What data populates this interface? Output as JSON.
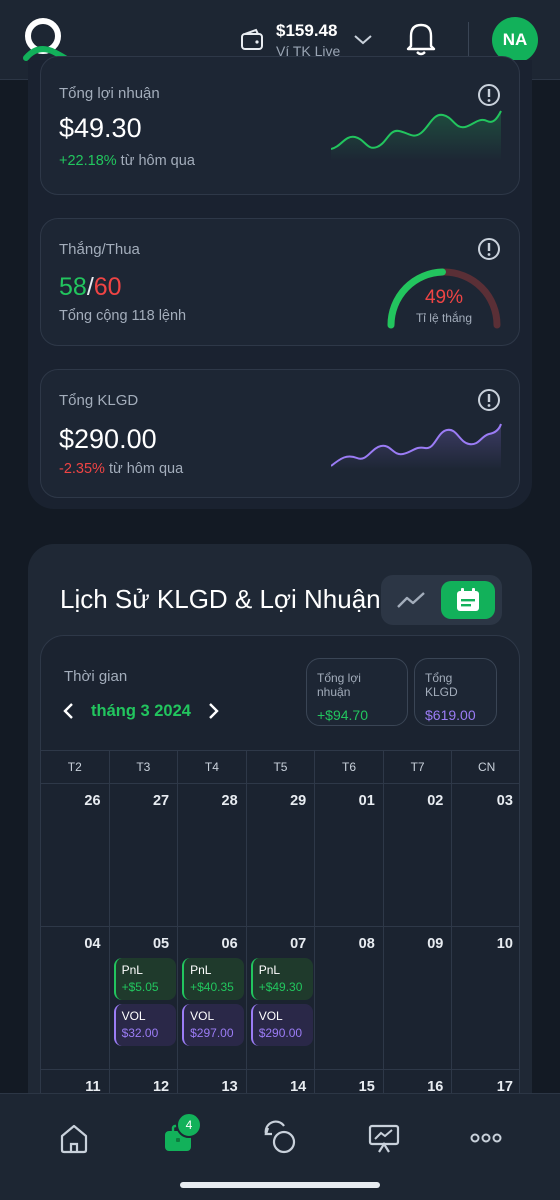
{
  "header": {
    "wallet_balance": "$159.48",
    "wallet_label": "Ví TK Live",
    "avatar_initials": "NA"
  },
  "stats": {
    "profit": {
      "title": "Tổng lợi nhuận",
      "value": "$49.30",
      "change": "+22.18%",
      "change_suffix": " từ hôm qua"
    },
    "winloss": {
      "title": "Thắng/Thua",
      "wins": "58",
      "separator": "/",
      "losses": "60",
      "total": "Tổng cộng 118 lệnh",
      "rate": "49%",
      "rate_label": "Tỉ lệ thắng",
      "win_fraction": 0.49
    },
    "volume": {
      "title": "Tổng KLGD",
      "value": "$290.00",
      "change": "-2.35%",
      "change_suffix": " từ hôm qua"
    }
  },
  "history": {
    "title": "Lịch Sử KLGD & Lợi Nhuận",
    "time_label": "Thời gian",
    "month": "tháng 3 2024",
    "total_profit_label": "Tổng lợi nhuận",
    "total_profit": "+$94.70",
    "total_volume_label": "Tổng KLGD",
    "total_volume": "$619.00",
    "weekdays": [
      "T2",
      "T3",
      "T4",
      "T5",
      "T6",
      "T7",
      "CN"
    ],
    "weeks": [
      [
        {
          "d": "26"
        },
        {
          "d": "27"
        },
        {
          "d": "28"
        },
        {
          "d": "29"
        },
        {
          "d": "01"
        },
        {
          "d": "02"
        },
        {
          "d": "03"
        }
      ],
      [
        {
          "d": "04"
        },
        {
          "d": "05",
          "pnl": "+$5.05",
          "vol": "$32.00"
        },
        {
          "d": "06",
          "pnl": "+$40.35",
          "vol": "$297.00"
        },
        {
          "d": "07",
          "pnl": "+$49.30",
          "vol": "$290.00"
        },
        {
          "d": "08"
        },
        {
          "d": "09"
        },
        {
          "d": "10"
        }
      ],
      [
        {
          "d": "11"
        },
        {
          "d": "12"
        },
        {
          "d": "13"
        },
        {
          "d": "14"
        },
        {
          "d": "15"
        },
        {
          "d": "16"
        },
        {
          "d": "17"
        }
      ]
    ],
    "pnl_key": "PnL",
    "vol_key": "VOL"
  },
  "nav": {
    "badge_count": "4"
  },
  "colors": {
    "accent": "#12b15a",
    "positive": "#22c55e",
    "negative": "#ef4444",
    "volume": "#9b7cf5"
  }
}
